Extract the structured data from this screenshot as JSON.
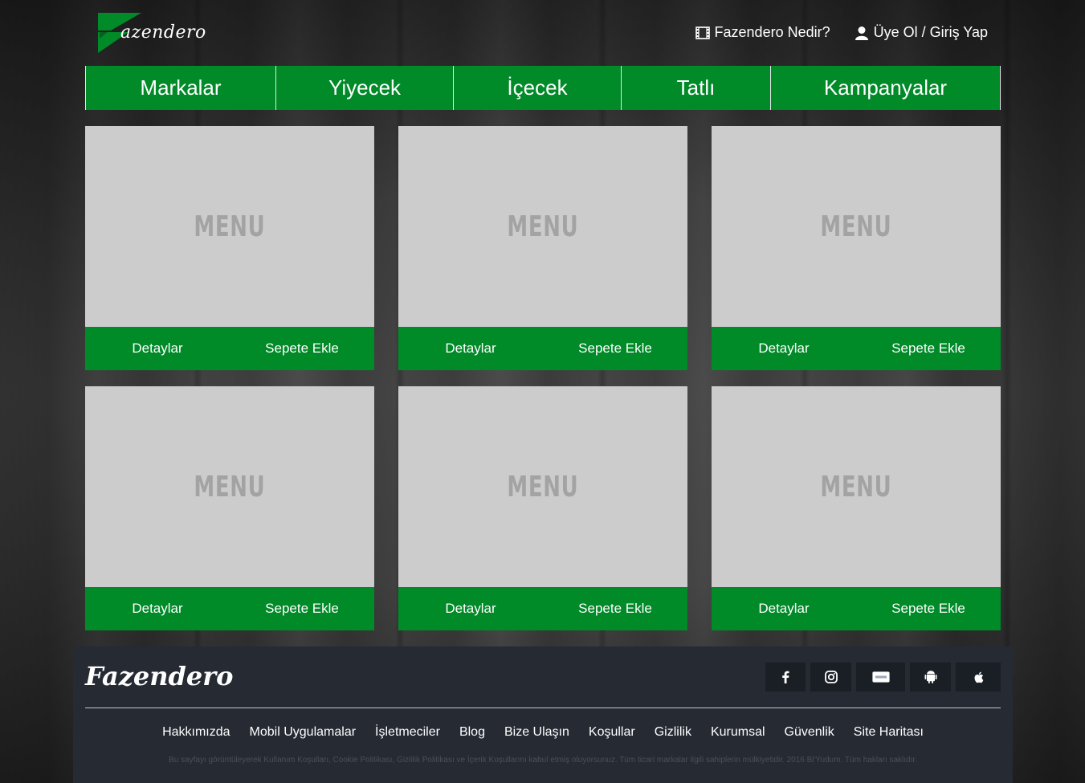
{
  "brand": {
    "logo_text": "azendero",
    "footer_logo": "Fazendero",
    "accent": "#008a28"
  },
  "header": {
    "links": [
      {
        "label": "Fazendero Nedir?",
        "icon": "film-icon"
      },
      {
        "label": "Üye Ol / Giriş Yap",
        "icon": "user-icon"
      }
    ]
  },
  "nav": {
    "items": [
      {
        "label": "Markalar"
      },
      {
        "label": "Yiyecek"
      },
      {
        "label": "İçecek"
      },
      {
        "label": "Tatlı"
      },
      {
        "label": "Kampanyalar"
      }
    ]
  },
  "cards": [
    {
      "image_text": "MENU",
      "details_label": "Detaylar",
      "cart_label": "Sepete Ekle"
    },
    {
      "image_text": "MENU",
      "details_label": "Detaylar",
      "cart_label": "Sepete Ekle"
    },
    {
      "image_text": "MENU",
      "details_label": "Detaylar",
      "cart_label": "Sepete Ekle"
    },
    {
      "image_text": "MENU",
      "details_label": "Detaylar",
      "cart_label": "Sepete Ekle"
    },
    {
      "image_text": "MENU",
      "details_label": "Detaylar",
      "cart_label": "Sepete Ekle"
    },
    {
      "image_text": "MENU",
      "details_label": "Detaylar",
      "cart_label": "Sepete Ekle"
    }
  ],
  "footer": {
    "socials": [
      "facebook-icon",
      "instagram-icon",
      "paypal-icon",
      "android-icon",
      "apple-icon"
    ],
    "links": [
      {
        "label": "Hakkımızda"
      },
      {
        "label": "Mobil Uygulamalar"
      },
      {
        "label": "İşletmeciler"
      },
      {
        "label": "Blog"
      },
      {
        "label": "Bize Ulaşın"
      },
      {
        "label": "Koşullar"
      },
      {
        "label": "Gizlilik"
      },
      {
        "label": "Kurumsal"
      },
      {
        "label": "Güvenlik"
      },
      {
        "label": "Site Haritası"
      }
    ],
    "copyright": "Bu sayfayı görüntüleyerek Kullanım Koşulları, Cookie Politikası, Gizlilik Politikası ve İçerik Koşullarını kabul etmiş oluyorsunuz. Tüm ticari markalar ilgili sahiplerin mülkiyetidir. 2016 Bi'Yudum. Tüm hakları saklıdır."
  }
}
